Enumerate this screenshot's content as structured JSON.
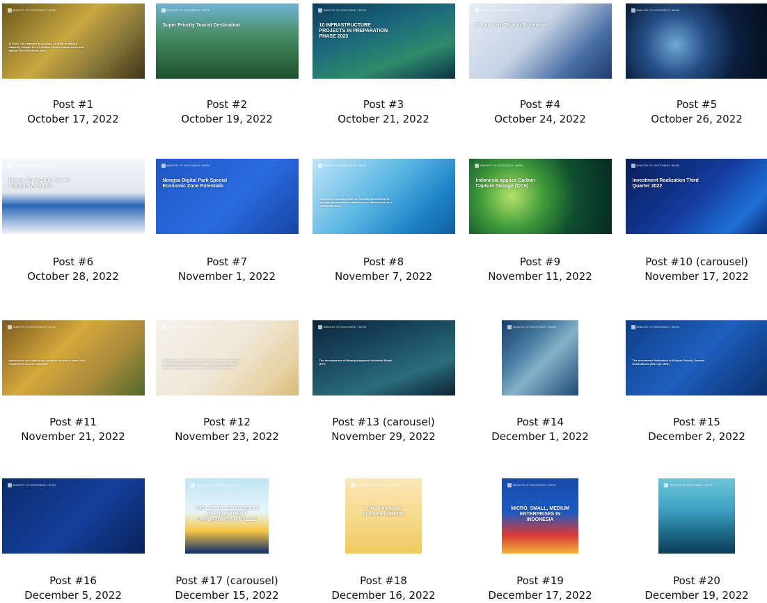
{
  "posts": [
    {
      "label": "Post #1",
      "date": "October 17, 2022",
      "bg": "linear-gradient(135deg,#6b5a1e 0%,#c9a742 45%,#8a7a3a 70%,#3d3418 100%)",
      "caption": "In 2024, it is expected to produce 10 GWh of battery capacity, enough for 1.4 million electric motorcycles and almost 100,000 electric cars."
    },
    {
      "label": "Post #2",
      "date": "October 19, 2022",
      "bg": "linear-gradient(180deg,#6fb3d6 0%,#4a8f6b 40%,#2f6b3f 75%,#1f4f2c 100%)",
      "caption": "Super Priority Tourist Destination"
    },
    {
      "label": "Post #3",
      "date": "October 21, 2022",
      "bg": "linear-gradient(160deg,#0d3c5a 0%,#1c6a7d 40%,#2f8a6a 70%,#0b3347 100%)",
      "caption": "10 INFRASTRUCTURE PROJECTS IN PREPARATION PHASE 2023"
    },
    {
      "label": "Post #4",
      "date": "October 24, 2022",
      "bg": "linear-gradient(135deg,#e8eef6 0%,#c7d3e4 45%,#4a6fa5 75%,#1f3b6b 100%)",
      "caption": "Batam Aero Technic Potentials"
    },
    {
      "label": "Post #5",
      "date": "October 26, 2022",
      "bg": "radial-gradient(circle at 35% 55%,#6fa7d8 0%,#264f86 30%,#0b1f3e 60%,#050d1c 100%)",
      "caption": ""
    },
    {
      "label": "Post #6",
      "date": "October 28, 2022",
      "bg": "linear-gradient(180deg,#f5f7fa 0%,#dfe6ee 45%,#2a66b8 62%,#f0f3f7 100%)",
      "caption": "Luxury Good Sales Tax for Automotive Sector"
    },
    {
      "label": "Post #7",
      "date": "November 1, 2022",
      "bg": "linear-gradient(135deg,#1f57c3 0%,#2a6be0 55%,#1746a3 100%)",
      "caption": "Nongsa Digital Park Special Economic Zone Potentials"
    },
    {
      "label": "Post #8",
      "date": "November 7, 2022",
      "bg": "linear-gradient(135deg,#bfe4f6 0%,#5db7e3 45%,#1f84c8 75%,#0f5e9e 100%)",
      "caption": "Indonesia is working with the German government to develop semiconductor factories and skilled workers in semiconductors."
    },
    {
      "label": "Post #9",
      "date": "November 11, 2022",
      "bg": "radial-gradient(circle at 30% 50%,#b4e26a 0%,#3f9a3a 30%,#0f4e2f 60%,#072a22 100%)",
      "caption": "Indonesia applies Carbon Capture Storage (CCS)"
    },
    {
      "label": "Post #10 (carousel)",
      "date": "November 17, 2022",
      "bg": "linear-gradient(135deg,#0a1e5a 0%,#143a9b 50%,#1e6fd6 80%,#0a2a74 100%)",
      "caption": "Investment Realization Third Quarter 2022"
    },
    {
      "label": "Post #11",
      "date": "November 21, 2022",
      "bg": "linear-gradient(135deg,#7a5a22 0%,#d5a93a 40%,#a88a3b 70%,#4f6a2a 100%)",
      "caption": "Indonesia's corn starch and sorghum products have been exported to several countries."
    },
    {
      "label": "Post #12",
      "date": "November 23, 2022",
      "bg": "linear-gradient(135deg,#f4f2ee 0%,#efe7d6 50%,#e6d3a6 80%,#d9b977 100%)",
      "caption": "Phytopharmaceuticals also represent a massive potential market, as traditional medicines were proven to be widely used by Indonesians during the COVID-19 pandemic."
    },
    {
      "label": "Post #13 (carousel)",
      "date": "November 29, 2022",
      "bg": "linear-gradient(160deg,#0d2438 0%,#1b4b62 40%,#2a6d7a 70%,#0c2233 100%)",
      "caption": "The development of Batang Integrated Industrial Estate (KIT)"
    },
    {
      "label": "Post #14",
      "date": "December 1, 2022",
      "bg": "linear-gradient(135deg,#1a3f6b 0%,#4a7ea3 35%,#86b2c8 55%,#1c4a74 100%)",
      "caption": ""
    },
    {
      "label": "Post #15",
      "date": "December 2, 2022",
      "bg": "linear-gradient(135deg,#0e3e86 0%,#1f5fbf 50%,#0a2f6b 100%)",
      "caption": "The Investment Realization in 5 Super-Priority Tourism Destinations (2017-Q2 2022)"
    },
    {
      "label": "Post #16",
      "date": "December 5, 2022",
      "bg": "linear-gradient(135deg,#0b2c6e 0%,#143f9a 55%,#0a225a 100%)",
      "caption": ""
    },
    {
      "label": "Post #17 (carousel)",
      "date": "December 15, 2022",
      "bg": "linear-gradient(180deg,#bfe6f5 0%,#e9f4f8 45%,#f4c542 70%,#0d2a6b 100%)",
      "caption": "THE LIST OF 22 PROJECTS OF INVESTMENT OPPORTUNITY MAP 2022"
    },
    {
      "label": "Post #18",
      "date": "December 16, 2022",
      "bg": "linear-gradient(180deg,#f9e7b8 0%,#f5d98a 55%,#f0c95f 100%)",
      "caption": "The Ministry of Investment/BKPM"
    },
    {
      "label": "Post #19",
      "date": "December 17, 2022",
      "bg": "linear-gradient(180deg,#1749a8 0%,#1c5bc2 45%,#d93a3a 75%,#f0b23a 100%)",
      "caption": "MICRO, SMALL, MEDIUM ENTERPRISES IN INDONESIA"
    },
    {
      "label": "Post #20",
      "date": "December 19, 2022",
      "bg": "linear-gradient(180deg,#6ec4d6 0%,#3fa3c1 40%,#1f6f8d 70%,#0e3c55 100%)",
      "caption": ""
    }
  ],
  "brand_text": "Ministry of Investment / BKPM"
}
